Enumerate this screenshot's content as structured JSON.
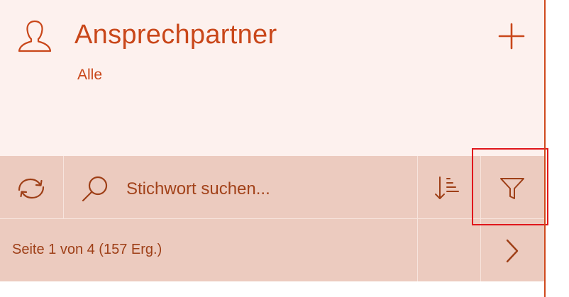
{
  "header": {
    "title": "Ansprechpartner",
    "subtitle": "Alle",
    "icons": {
      "person": "person-icon",
      "add": "plus-icon"
    }
  },
  "toolbar": {
    "search_placeholder": "Stichwort suchen...",
    "search_value": "",
    "icons": {
      "refresh": "refresh-icon",
      "search": "search-icon",
      "sort": "sort-icon",
      "filter": "filter-icon"
    }
  },
  "pager": {
    "page_info": "Seite 1 von 4 (157 Erg.)",
    "icons": {
      "next": "chevron-right-icon"
    }
  },
  "colors": {
    "accent": "#c9471a",
    "header_bg": "#fdf1ee",
    "toolbar_bg": "#eccbbf",
    "highlight": "#e0161b"
  }
}
